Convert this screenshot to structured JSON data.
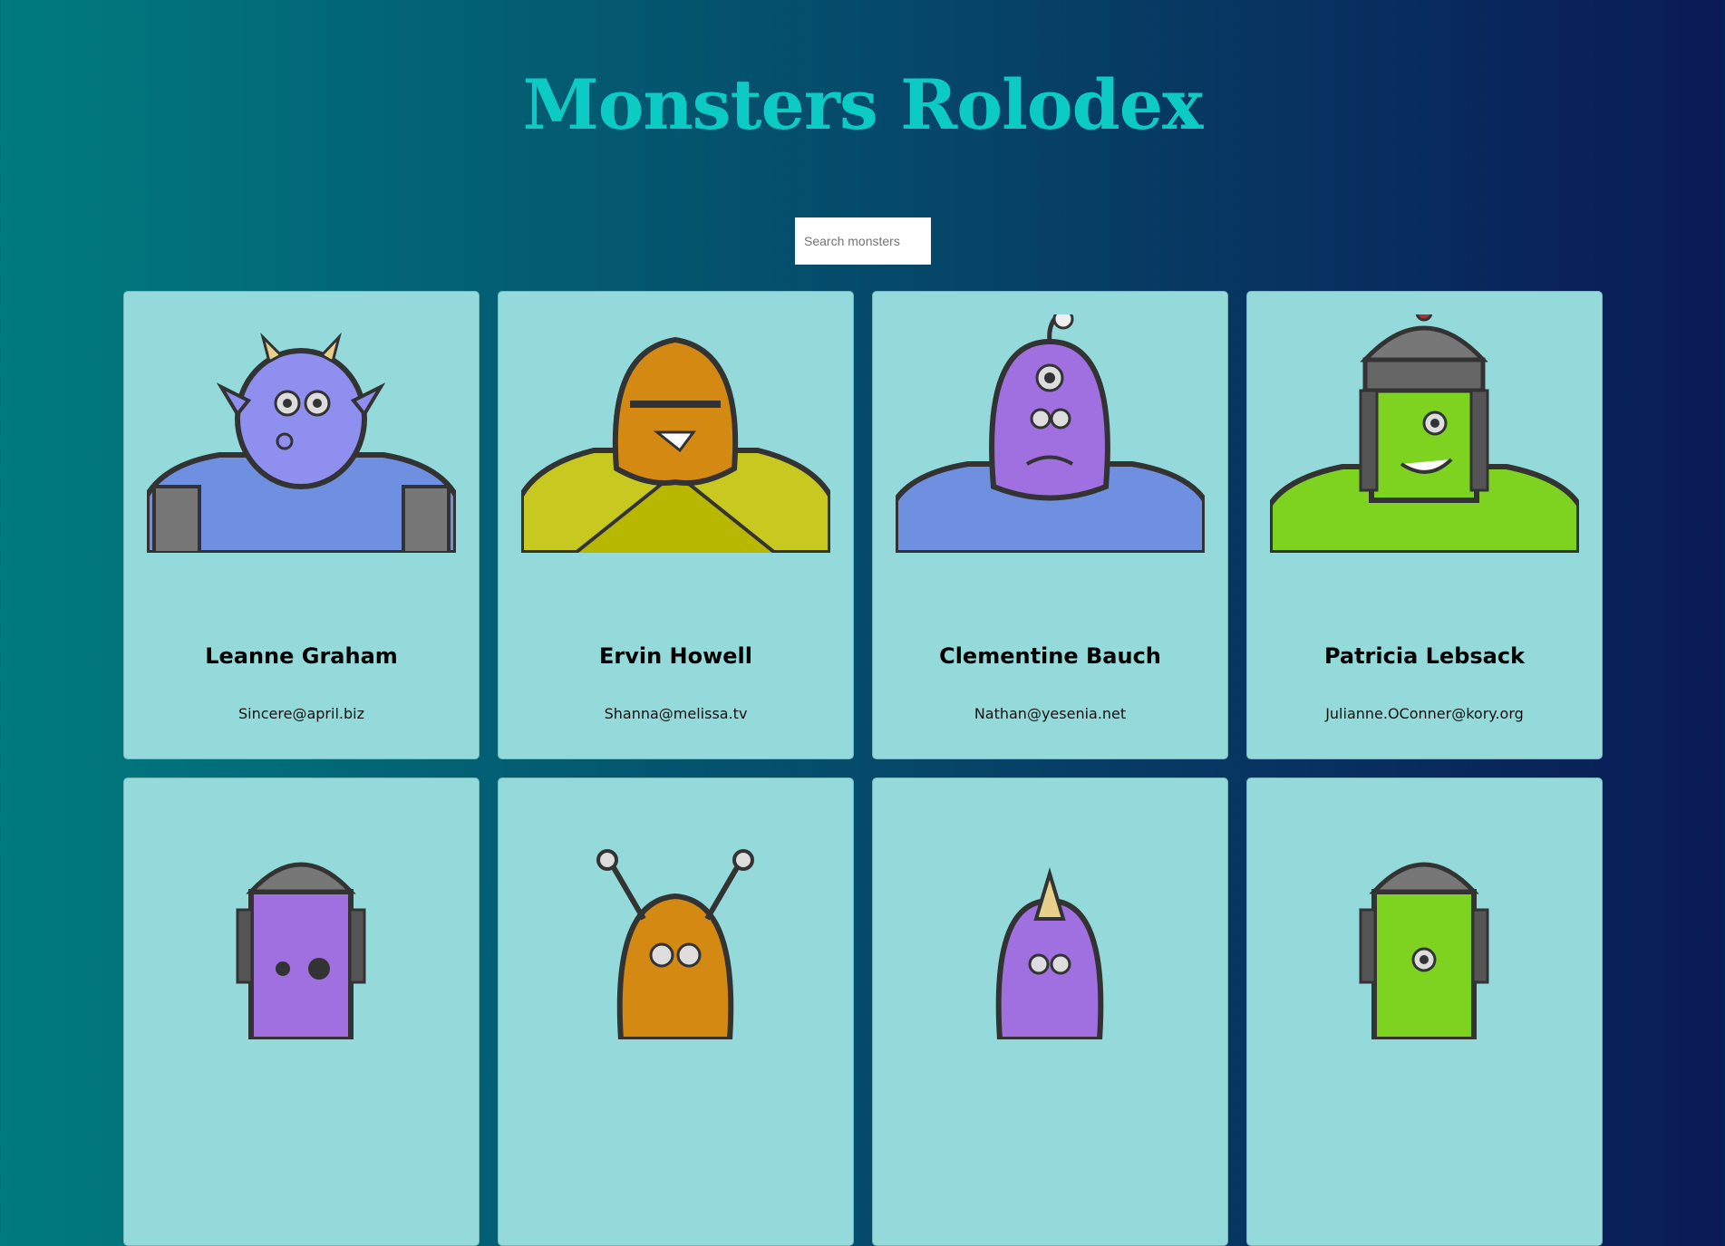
{
  "app": {
    "title": "Monsters Rolodex"
  },
  "search": {
    "placeholder": "Search monsters",
    "value": ""
  },
  "monsters": [
    {
      "name": "Leanne Graham",
      "email": "Sincere@april.biz",
      "color": "#8f8ff0",
      "icon": "horned-monster"
    },
    {
      "name": "Ervin Howell",
      "email": "Shanna@melissa.tv",
      "color": "#d48a12",
      "icon": "spiky-monster"
    },
    {
      "name": "Clementine Bauch",
      "email": "Nathan@yesenia.net",
      "color": "#a070e0",
      "icon": "cyclops-monster"
    },
    {
      "name": "Patricia Lebsack",
      "email": "Julianne.OConner@kory.org",
      "color": "#7ed321",
      "icon": "robot-monster"
    },
    {
      "name": "",
      "email": "",
      "color": "#a070e0",
      "icon": "helmet-monster"
    },
    {
      "name": "",
      "email": "",
      "color": "#d48a12",
      "icon": "antenna-monster"
    },
    {
      "name": "",
      "email": "",
      "color": "#a070e0",
      "icon": "horn-monster"
    },
    {
      "name": "",
      "email": "",
      "color": "#7ed321",
      "icon": "helmet-monster"
    }
  ]
}
